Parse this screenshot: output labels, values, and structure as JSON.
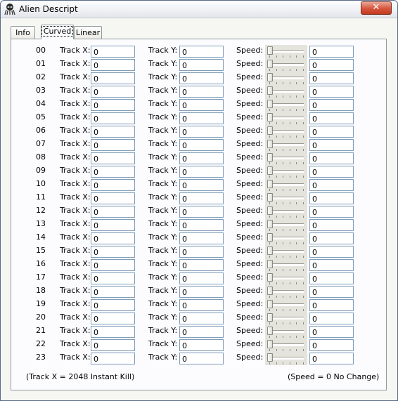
{
  "window": {
    "title": "Alien Descript"
  },
  "tabs": [
    {
      "label": "Info"
    },
    {
      "label": "Curved"
    },
    {
      "label": "Linear"
    }
  ],
  "labels": {
    "track_x": "Track X:",
    "track_y": "Track Y:",
    "speed": "Speed:"
  },
  "rows": [
    {
      "index": "00",
      "track_x": "0",
      "track_y": "0",
      "speed": "0",
      "slider_level": 0
    },
    {
      "index": "01",
      "track_x": "0",
      "track_y": "0",
      "speed": "0",
      "slider_level": 0
    },
    {
      "index": "02",
      "track_x": "0",
      "track_y": "0",
      "speed": "0",
      "slider_level": 0
    },
    {
      "index": "03",
      "track_x": "0",
      "track_y": "0",
      "speed": "0",
      "slider_level": 0
    },
    {
      "index": "04",
      "track_x": "0",
      "track_y": "0",
      "speed": "0",
      "slider_level": 0
    },
    {
      "index": "05",
      "track_x": "0",
      "track_y": "0",
      "speed": "0",
      "slider_level": 0
    },
    {
      "index": "06",
      "track_x": "0",
      "track_y": "0",
      "speed": "0",
      "slider_level": 0
    },
    {
      "index": "07",
      "track_x": "0",
      "track_y": "0",
      "speed": "0",
      "slider_level": 0
    },
    {
      "index": "08",
      "track_x": "0",
      "track_y": "0",
      "speed": "0",
      "slider_level": 0
    },
    {
      "index": "09",
      "track_x": "0",
      "track_y": "0",
      "speed": "0",
      "slider_level": 0
    },
    {
      "index": "10",
      "track_x": "0",
      "track_y": "0",
      "speed": "0",
      "slider_level": 0
    },
    {
      "index": "11",
      "track_x": "0",
      "track_y": "0",
      "speed": "0",
      "slider_level": 0
    },
    {
      "index": "12",
      "track_x": "0",
      "track_y": "0",
      "speed": "0",
      "slider_level": 0
    },
    {
      "index": "13",
      "track_x": "0",
      "track_y": "0",
      "speed": "0",
      "slider_level": 0
    },
    {
      "index": "14",
      "track_x": "0",
      "track_y": "0",
      "speed": "0",
      "slider_level": 0
    },
    {
      "index": "15",
      "track_x": "0",
      "track_y": "0",
      "speed": "0",
      "slider_level": 0
    },
    {
      "index": "16",
      "track_x": "0",
      "track_y": "0",
      "speed": "0",
      "slider_level": 0
    },
    {
      "index": "17",
      "track_x": "0",
      "track_y": "0",
      "speed": "0",
      "slider_level": 0
    },
    {
      "index": "18",
      "track_x": "0",
      "track_y": "0",
      "speed": "0",
      "slider_level": 0
    },
    {
      "index": "19",
      "track_x": "0",
      "track_y": "0",
      "speed": "0",
      "slider_level": 0
    },
    {
      "index": "20",
      "track_x": "0",
      "track_y": "0",
      "speed": "0",
      "slider_level": 0
    },
    {
      "index": "21",
      "track_x": "0",
      "track_y": "0",
      "speed": "0",
      "slider_level": 0
    },
    {
      "index": "22",
      "track_x": "0",
      "track_y": "0",
      "speed": "0",
      "slider_level": 0
    },
    {
      "index": "23",
      "track_x": "0",
      "track_y": "0",
      "speed": "0",
      "slider_level": 0
    }
  ],
  "footer": {
    "left_note": "(Track X = 2048 Instant Kill)",
    "right_note": "(Speed = 0 No Change)"
  },
  "icons": {
    "app": "alien-icon",
    "close": "close-icon"
  },
  "colors": {
    "input_border": "#7f9db9",
    "close_button": "#d7553b",
    "panel_border": "#919b9c"
  }
}
